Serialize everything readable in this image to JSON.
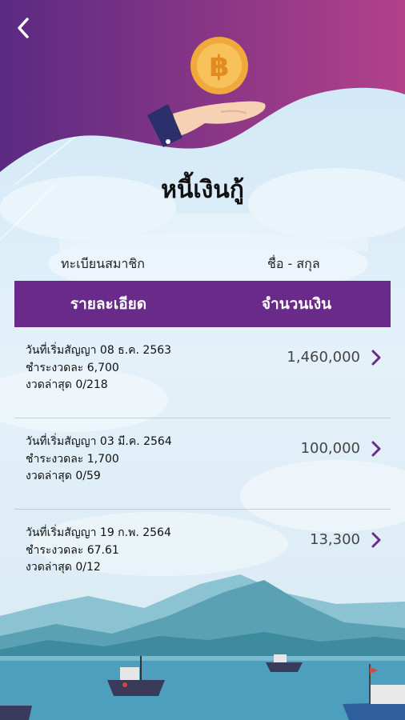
{
  "page": {
    "title": "หนี้เงินกู้"
  },
  "profile": {
    "member_label": "ทะเบียนสมาชิก",
    "name_label": "ชื่อ - สกุล"
  },
  "table": {
    "col_detail": "รายละเอียด",
    "col_amount": "จำนวนเงิน"
  },
  "loans": [
    {
      "start_date": "วันที่เริ่มสัญญา  08 ธ.ค. 2563",
      "installment": "ชำระงวดละ 6,700",
      "latest_period": "งวดล่าสุด  0/218",
      "amount": "1,460,000"
    },
    {
      "start_date": "วันที่เริ่มสัญญา  03 มี.ค. 2564",
      "installment": "ชำระงวดละ 1,700",
      "latest_period": "งวดล่าสุด  0/59",
      "amount": "100,000"
    },
    {
      "start_date": "วันที่เริ่มสัญญา  19 ก.พ. 2564",
      "installment": "ชำระงวดละ 67.61",
      "latest_period": "งวดล่าสุด  0/12",
      "amount": "13,300"
    }
  ],
  "icons": {
    "back": "back-arrow-icon",
    "coin": "baht-coin-icon",
    "hand": "hand-icon",
    "chevron": "chevron-right-icon"
  },
  "colors": {
    "header_start": "#5a2a82",
    "header_end": "#b3418a",
    "table_header": "#6a2a8a",
    "coin": "#f0a93a",
    "chevron": "#6a2a8a"
  }
}
